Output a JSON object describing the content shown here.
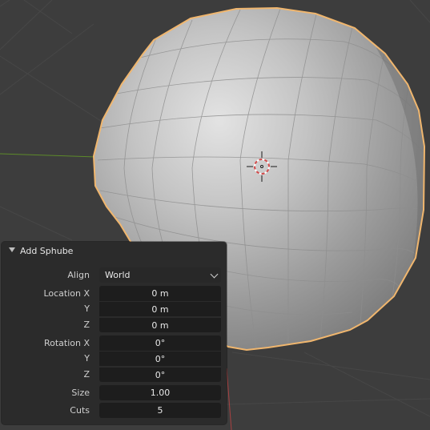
{
  "viewport": {
    "object": "sphere-mesh",
    "selection_outline_color": "#f0b66e",
    "axis_x_color": "#a84141",
    "axis_y_color": "#5d8a2a",
    "background_color": "#3d3d3d",
    "grid_color": "#474747",
    "cursor_icon": "3d-cursor-icon"
  },
  "operator_panel": {
    "title": "Add Sphube",
    "collapse_icon": "triangle-down-icon",
    "align_label": "Align",
    "align_value": "World",
    "location_x_label": "Location X",
    "location_x_value": "0 m",
    "location_y_label": "Y",
    "location_y_value": "0 m",
    "location_z_label": "Z",
    "location_z_value": "0 m",
    "rotation_x_label": "Rotation X",
    "rotation_x_value": "0°",
    "rotation_y_label": "Y",
    "rotation_y_value": "0°",
    "rotation_z_label": "Z",
    "rotation_z_value": "0°",
    "size_label": "Size",
    "size_value": "1.00",
    "cuts_label": "Cuts",
    "cuts_value": "5"
  }
}
